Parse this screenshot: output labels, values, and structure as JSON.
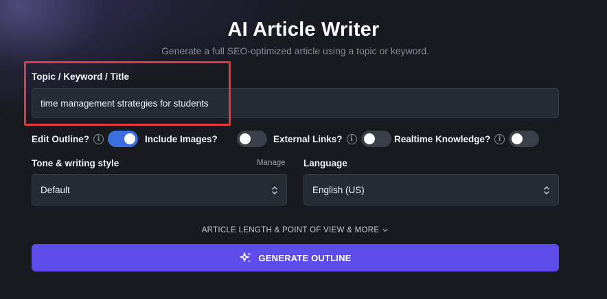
{
  "header": {
    "title": "AI Article Writer",
    "subtitle": "Generate a full SEO-optimized article using a topic or keyword."
  },
  "topic": {
    "label": "Topic / Keyword / Title",
    "value": "time management strategies for students"
  },
  "toggles": [
    {
      "label": "Edit Outline?",
      "on": true
    },
    {
      "label": "Include Images?",
      "on": false
    },
    {
      "label": "External Links?",
      "on": false
    },
    {
      "label": "Realtime Knowledge?",
      "on": false
    }
  ],
  "tone": {
    "label": "Tone & writing style",
    "manage_label": "Manage",
    "value": "Default"
  },
  "language": {
    "label": "Language",
    "value": "English (US)"
  },
  "more_options": {
    "label": "ARTICLE LENGTH & POINT OF VIEW & MORE"
  },
  "generate": {
    "label": "GENERATE OUTLINE"
  },
  "colors": {
    "accent_button": "#5e4cea",
    "toggle_on": "#3b6fe0",
    "highlight": "#e5373f",
    "background": "#181a20"
  }
}
